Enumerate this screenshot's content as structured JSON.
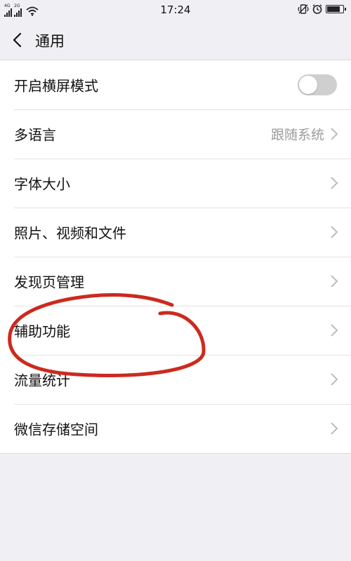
{
  "status_bar": {
    "network_1": "4G",
    "network_2": "2G",
    "time": "17:24",
    "icons": [
      "signal-icon",
      "signal-icon",
      "wifi-icon",
      "vibrate-icon",
      "alarm-icon",
      "battery-icon"
    ],
    "battery_level": 0.85
  },
  "header": {
    "title": "通用",
    "back_icon": "chevron-left-icon"
  },
  "settings": {
    "items": [
      {
        "label": "开启横屏模式",
        "control": "toggle",
        "toggle_on": false
      },
      {
        "label": "多语言",
        "value": "跟随系统",
        "control": "chevron"
      },
      {
        "label": "字体大小",
        "control": "chevron"
      },
      {
        "label": "照片、视频和文件",
        "control": "chevron"
      },
      {
        "label": "发现页管理",
        "control": "chevron"
      },
      {
        "label": "辅助功能",
        "control": "chevron",
        "annotated": true
      },
      {
        "label": "流量统计",
        "control": "chevron"
      },
      {
        "label": "微信存储空间",
        "control": "chevron"
      }
    ]
  },
  "colors": {
    "background": "#efeff4",
    "annotation_stroke": "#cc2a1e",
    "toggle_off": "#cfcfcf",
    "secondary_text": "#9b9b9b"
  }
}
